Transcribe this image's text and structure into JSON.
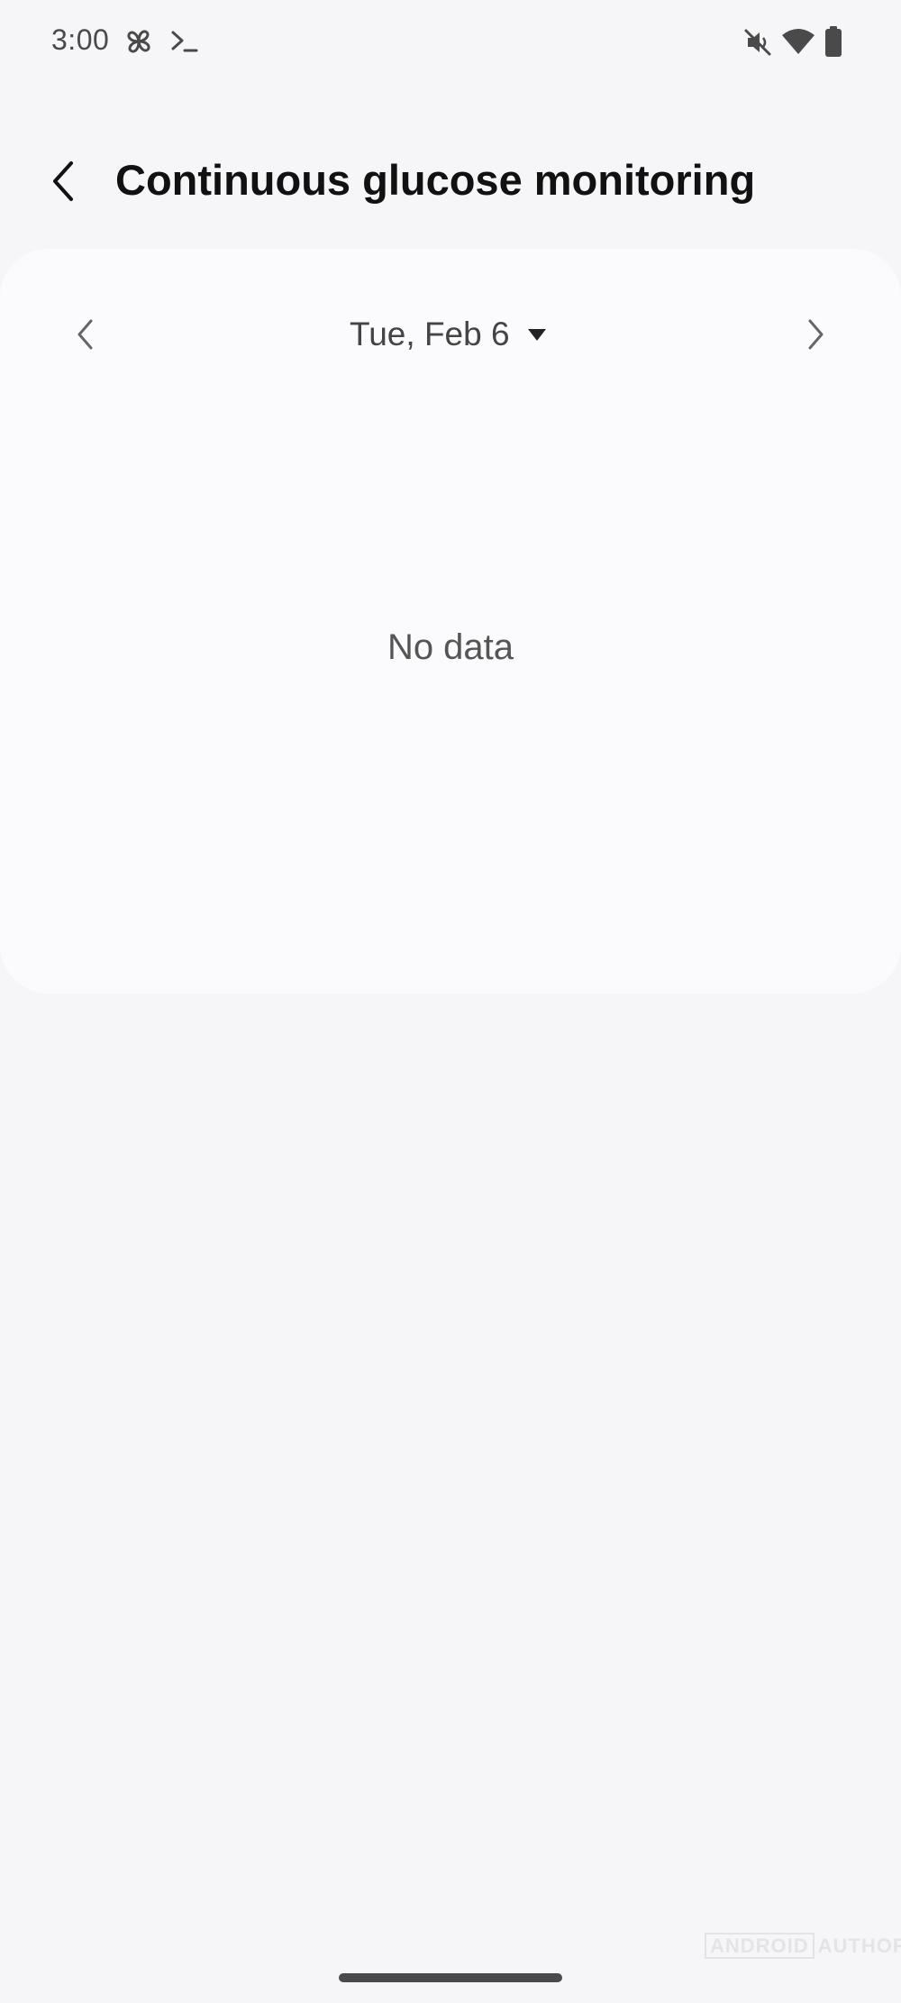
{
  "status_bar": {
    "time": "3:00",
    "left_icons": [
      "pinwheel-icon",
      "terminal-icon"
    ],
    "right_icons": [
      "mute-icon",
      "wifi-icon",
      "battery-icon"
    ]
  },
  "header": {
    "back_icon": "back-arrow-icon",
    "title": "Continuous glucose monitoring"
  },
  "date_nav": {
    "prev_icon": "chevron-left-icon",
    "date": "Tue, Feb 6",
    "dropdown_icon": "caret-down-icon",
    "next_icon": "chevron-right-icon"
  },
  "content": {
    "empty_message": "No data"
  },
  "watermark": {
    "text_boxed": "ANDROID",
    "text_plain": "AUTHORITY"
  },
  "colors": {
    "background": "#f6f6f8",
    "card": "#fbfbfe",
    "title": "#111111",
    "secondary_text": "#555555"
  }
}
